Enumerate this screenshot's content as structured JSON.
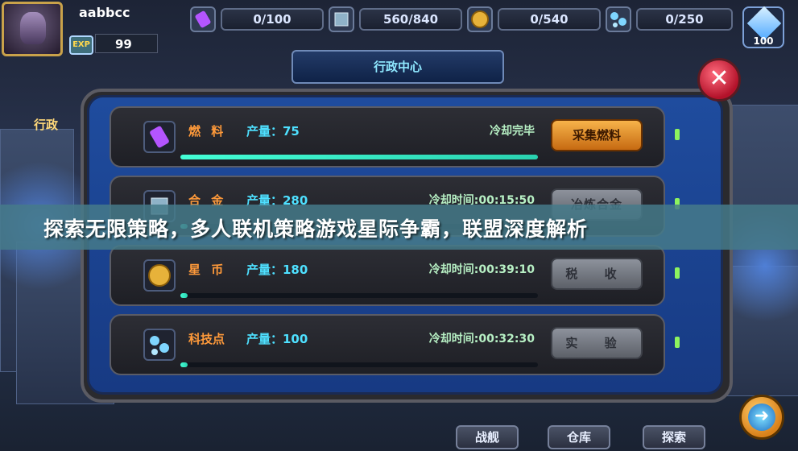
{
  "player": {
    "name": "aabbcc",
    "exp_label": "EXP",
    "exp_value": "99"
  },
  "resources": [
    {
      "icon": "fuel-canister-icon",
      "value": "0/100"
    },
    {
      "icon": "alloy-crate-icon",
      "value": "560/840"
    },
    {
      "icon": "star-coin-icon",
      "value": "0/540"
    },
    {
      "icon": "tech-molecule-icon",
      "value": "0/250"
    }
  ],
  "crystal": {
    "icon": "crystal-icon",
    "value": "100"
  },
  "panel": {
    "title": "行政中心",
    "side_label": "行政"
  },
  "rows": [
    {
      "name": "燃 料",
      "production": "产量：75",
      "cooldown": "冷却完毕",
      "button": "采集燃料",
      "active": true,
      "progress": 1.0,
      "icon": "fuel-canister-icon"
    },
    {
      "name": "合 金",
      "production": "产量：280",
      "cooldown": "冷却时间:00:15:50",
      "button": "冶炼合金",
      "active": false,
      "progress": 0.02,
      "icon": "alloy-crate-icon"
    },
    {
      "name": "星 币",
      "production": "产量：180",
      "cooldown": "冷却时间:00:39:10",
      "button": "税 收",
      "active": false,
      "progress": 0.02,
      "icon": "star-coin-icon"
    },
    {
      "name": "科技点",
      "production": "产量：100",
      "cooldown": "冷却时间:00:32:30",
      "button": "实 验",
      "active": false,
      "progress": 0.02,
      "icon": "tech-molecule-icon"
    }
  ],
  "banner": {
    "text": "探索无限策略，多人联机策略游戏星际争霸，联盟深度解析"
  },
  "bottom_tabs": [
    "战舰",
    "仓库",
    "探索"
  ],
  "colors": {
    "panel_blue": "#1f4c9e",
    "accent_orange": "#f7b34a",
    "production_cyan": "#4ee0ff",
    "resource_name": "#ff9a3a",
    "close_red": "#d0203a"
  }
}
